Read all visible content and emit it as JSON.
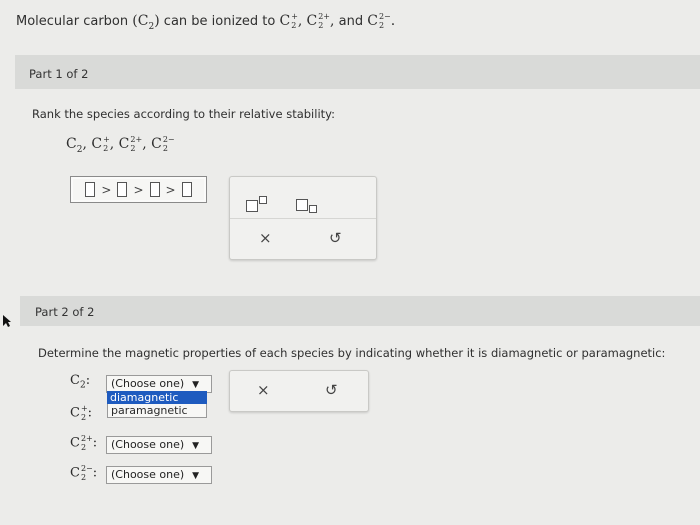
{
  "question": {
    "prefix": "Molecular carbon",
    "suffix": "can be ionized to",
    "and": "and",
    "end": "."
  },
  "species": {
    "C2": {
      "base": "C",
      "sub": "2",
      "sup": ""
    },
    "C2plus": {
      "base": "C",
      "sub": "2",
      "sup": "+"
    },
    "C2plus2": {
      "base": "C",
      "sub": "2",
      "sup": "2+"
    },
    "C2minus2": {
      "base": "C",
      "sub": "2",
      "sup": "2−"
    }
  },
  "part1": {
    "label": "Part 1 of 2",
    "prompt": "Rank the species according to their relative stability:",
    "ranking_separator": ">",
    "toolbox": {
      "clear_icon": "×",
      "undo_icon": "↺"
    }
  },
  "part2": {
    "label": "Part 2 of 2",
    "prompt": "Determine the magnetic properties of each species by indicating whether it is diamagnetic or paramagnetic:",
    "rows": [
      {
        "species": "C2",
        "select_value": "(Choose one)"
      },
      {
        "species": "C2plus",
        "select_value": ""
      },
      {
        "species": "C2plus2",
        "select_value": "(Choose one)"
      },
      {
        "species": "C2minus2",
        "select_value": "(Choose one)"
      }
    ],
    "dropdown_options": [
      "diamagnetic",
      "paramagnetic"
    ],
    "caret": "▼",
    "toolbox": {
      "clear_icon": "×",
      "undo_icon": "↺"
    }
  }
}
